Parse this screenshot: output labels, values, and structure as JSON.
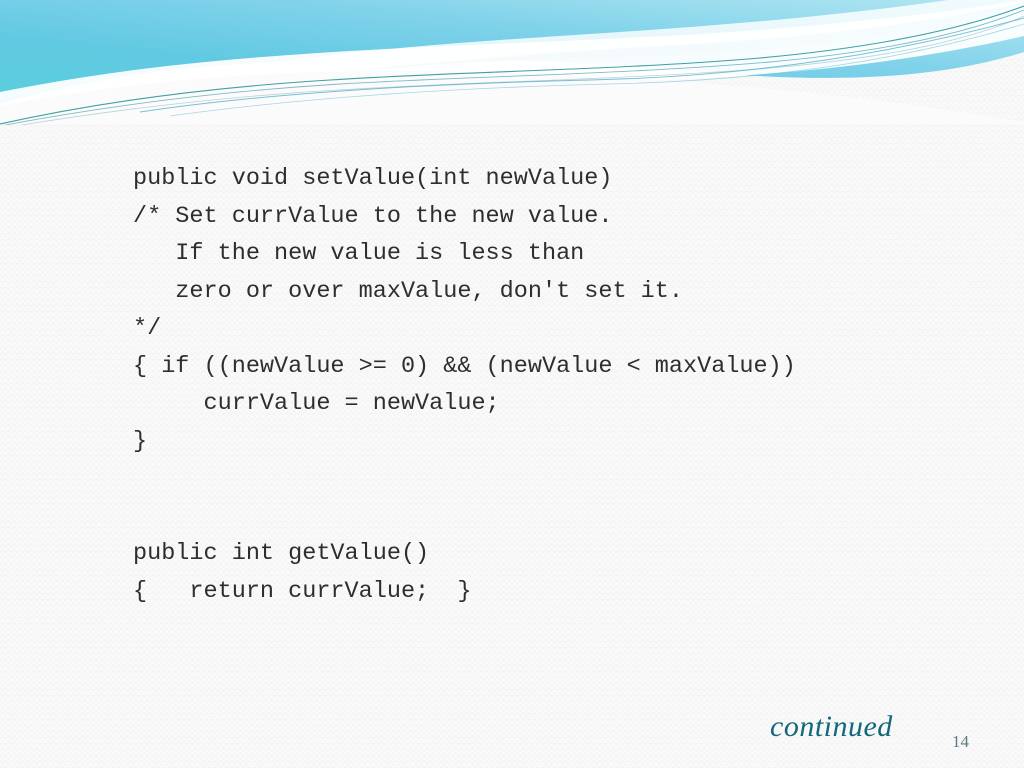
{
  "slide": {
    "background_color": "#fafafa",
    "page_number": "14",
    "continued_label": "continued",
    "continued_color": "#10687a",
    "page_number_color": "#5c7b80"
  },
  "header": {
    "name": "decorative-wave-banner",
    "gradient_start": "#5fd0dd",
    "gradient_mid": "#6fc6e4",
    "gradient_end": "#a9e2ef",
    "accent_line_color": "#1f8f92",
    "accent_line_color_2": "#3fa6c4",
    "band_color": "#5bbcd9",
    "swoosh_color": "#ffffff"
  },
  "code": {
    "text_color": "#2e2e2e",
    "font_size_px": 23.5,
    "lines": [
      "public void setValue(int newValue)",
      "/* Set currValue to the new value.",
      "   If the new value is less than",
      "   zero or over maxValue, don't set it.",
      "*/",
      "{ if ((newValue >= 0) && (newValue < maxValue))",
      "     currValue = newValue;",
      "}",
      "",
      "",
      "public int getValue()",
      "{   return currValue;  }"
    ]
  }
}
